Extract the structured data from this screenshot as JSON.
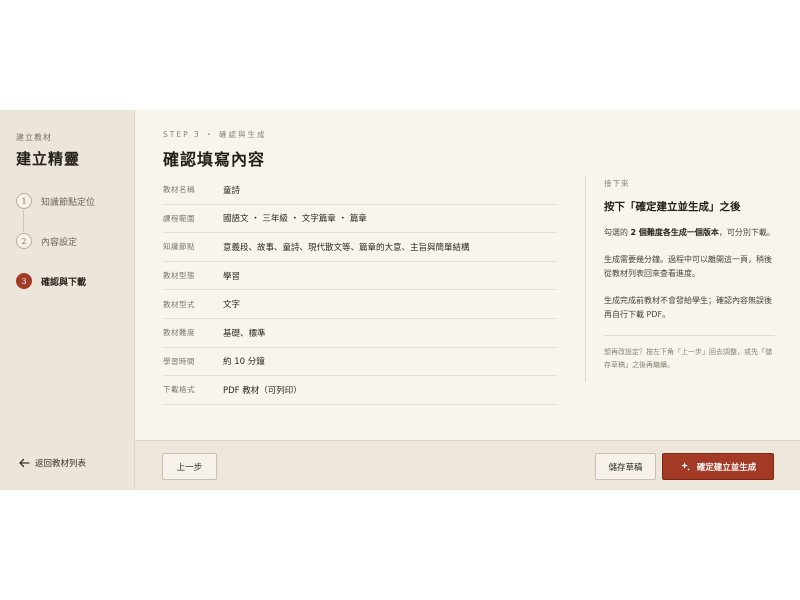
{
  "sidebar": {
    "kicker": "建立教材",
    "title": "建立精靈",
    "steps": [
      {
        "num": "1",
        "label": "知識節點定位",
        "state": "done"
      },
      {
        "num": "2",
        "label": "內容設定",
        "state": "done"
      },
      {
        "num": "3",
        "label": "確認與下載",
        "state": "active"
      }
    ],
    "back_label": "返回教材列表"
  },
  "main": {
    "step_kicker": "STEP 3 ・ 確認與生成",
    "title": "確認填寫內容",
    "summary": [
      {
        "label": "教材名稱",
        "value": "童詩"
      },
      {
        "label": "課程範圍",
        "value": "國語文 ・ 三年級 ・ 文字篇章 ・ 篇章"
      },
      {
        "label": "知識節點",
        "value": "意義段、故事、童詩、現代散文等、篇章的大意、主旨與簡單結構"
      },
      {
        "label": "教材型態",
        "value": "學習"
      },
      {
        "label": "教材型式",
        "value": "文字"
      },
      {
        "label": "教材難度",
        "value": "基礎、標準"
      },
      {
        "label": "學習時間",
        "value": "約 10 分鐘"
      },
      {
        "label": "下載格式",
        "value": "PDF 教材（可列印）"
      }
    ]
  },
  "note": {
    "kicker": "接下來",
    "heading": "按下「確定建立並生成」之後",
    "p1_pre": "勾選的 ",
    "p1_bold": "2 個難度各生成一個版本",
    "p1_post": "，可分別下載。",
    "p2": "生成需要幾分鐘。過程中可以離開這一頁，稍後從教材列表回來查看進度。",
    "p3": "生成完成前教材不會發給學生；確認內容無誤後再自行下載 PDF。",
    "hint": "想再改設定？按左下角「上一步」回去調整，或先「儲存草稿」之後再繼續。"
  },
  "footer": {
    "prev_label": "上一步",
    "draft_label": "儲存草稿",
    "primary_label": "確定建立並生成"
  },
  "colors": {
    "accent": "#a23a26",
    "sidebar_bg": "#ece5d9",
    "main_bg": "#f8f5ef"
  },
  "icons": {
    "back": "arrow-left-icon",
    "primary": "sparkle-icon"
  }
}
